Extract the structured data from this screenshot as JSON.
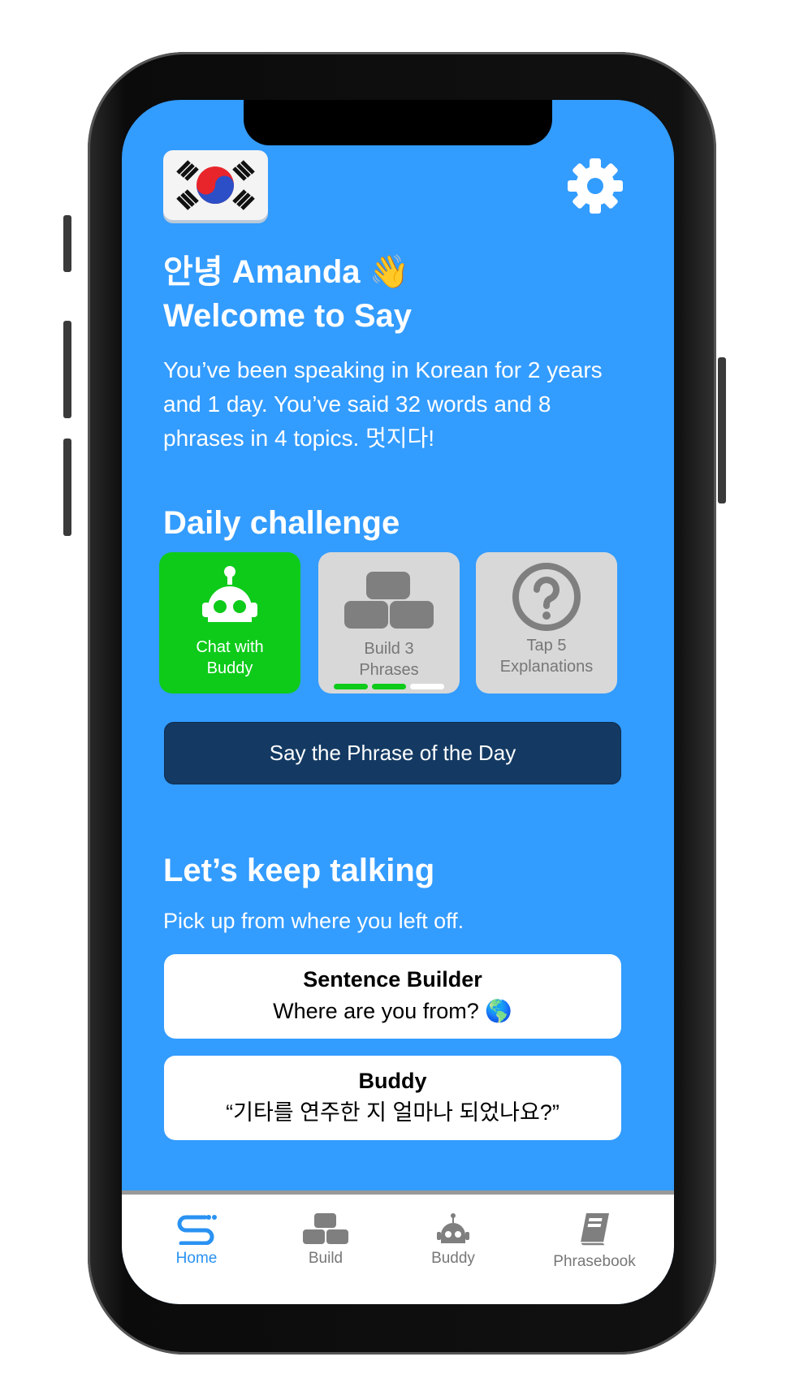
{
  "header": {
    "greeting": "안녕 Amanda 👋",
    "welcome": "Welcome to Say"
  },
  "summary": "You’ve been speaking in Korean for 2 years and 1 day. You’ve said 32 words and 8 phrases in 4 topics. 멋지다!",
  "daily_challenge": {
    "title": "Daily challenge",
    "tiles": [
      {
        "label_line1": "Chat with",
        "label_line2": "Buddy",
        "status": "complete",
        "color": "#0ecb1a"
      },
      {
        "label_line1": "Build 3",
        "label_line2": "Phrases",
        "progress": 2,
        "total": 3
      },
      {
        "label_line1": "Tap 5",
        "label_line2": "Explanations"
      }
    ],
    "phrase_button": "Say the Phrase of the Day"
  },
  "keep_talking": {
    "title": "Let’s keep talking",
    "subtitle": "Pick up from where you left off.",
    "cards": [
      {
        "title": "Sentence Builder",
        "subtitle": "Where are you from? 🌎"
      },
      {
        "title": "Buddy",
        "subtitle": "“기타를 연주한 지 얼마나 되었나요?”"
      }
    ]
  },
  "nav": {
    "items": [
      {
        "label": "Home",
        "active": true
      },
      {
        "label": "Build"
      },
      {
        "label": "Buddy"
      },
      {
        "label": "Phrasebook"
      }
    ]
  },
  "colors": {
    "background": "#339cff",
    "accent_dark": "#143a63",
    "green": "#0ecb1a",
    "tile_gray": "#d8d8d8"
  }
}
